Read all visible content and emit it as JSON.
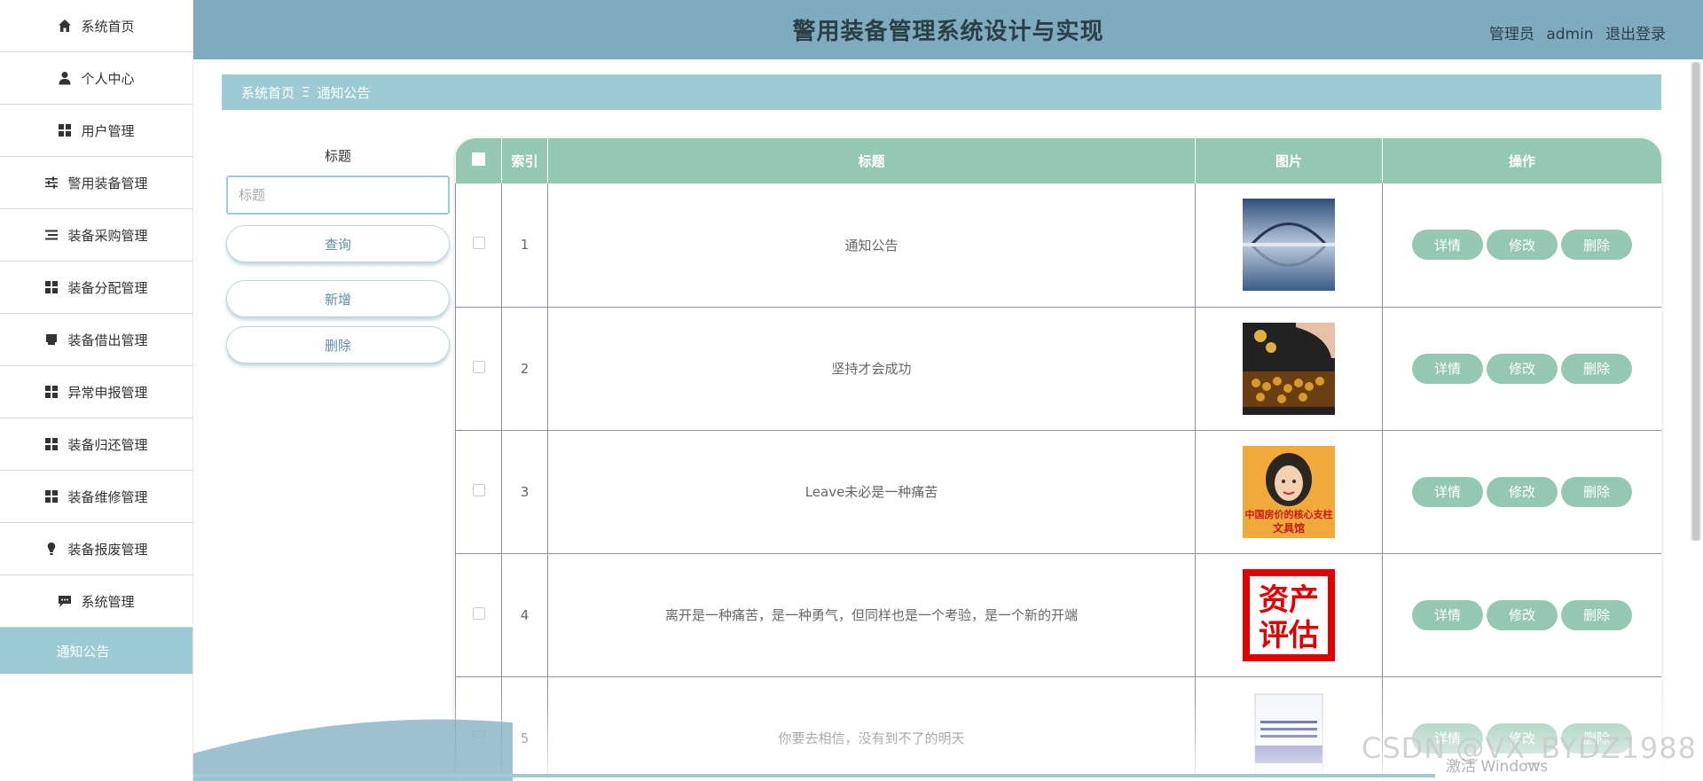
{
  "sidebar": {
    "items": [
      {
        "label": "系统首页",
        "icon": "home-icon"
      },
      {
        "label": "个人中心",
        "icon": "user-icon"
      },
      {
        "label": "用户管理",
        "icon": "grid-icon"
      },
      {
        "label": "警用装备管理",
        "icon": "sliders-icon"
      },
      {
        "label": "装备采购管理",
        "icon": "list-icon"
      },
      {
        "label": "装备分配管理",
        "icon": "grid-icon"
      },
      {
        "label": "装备借出管理",
        "icon": "inbox-icon"
      },
      {
        "label": "异常申报管理",
        "icon": "grid-icon"
      },
      {
        "label": "装备归还管理",
        "icon": "grid-icon"
      },
      {
        "label": "装备维修管理",
        "icon": "grid-icon"
      },
      {
        "label": "装备报废管理",
        "icon": "bulb-icon"
      },
      {
        "label": "系统管理",
        "icon": "chat-icon"
      }
    ],
    "active_sub": "通知公告"
  },
  "header": {
    "title": "警用装备管理系统设计与实现",
    "role": "管理员",
    "username": "admin",
    "logout": "退出登录"
  },
  "breadcrumb": {
    "home": "系统首页",
    "separator": "Ξ",
    "current": "通知公告"
  },
  "search": {
    "label": "标题",
    "placeholder": "标题",
    "query_button": "查询",
    "add_button": "新增",
    "delete_button": "删除"
  },
  "table": {
    "columns": [
      "索引",
      "标题",
      "图片",
      "操作"
    ],
    "actions": [
      "详情",
      "修改",
      "删除"
    ],
    "rows": [
      {
        "index": "1",
        "title": "通知公告",
        "image": "bridge-reflection-thumbnail"
      },
      {
        "index": "2",
        "title": "坚持才会成功",
        "image": "abacus-coins-thumbnail"
      },
      {
        "index": "3",
        "title": "Leave未必是一种痛苦",
        "image": "book-cover-portrait-thumbnail"
      },
      {
        "index": "4",
        "title": "离开是一种痛苦，是一种勇气，但同样也是一个考验，是一个新的开端",
        "image": "asset-valuation-stamp-thumbnail"
      },
      {
        "index": "5",
        "title": "你要去相信，没有到不了的明天",
        "image": "document-cover-thumbnail"
      }
    ]
  },
  "overlay": {
    "watermark": "CSDN @VX_BYDZ1988",
    "activate_windows": "激活 Windows"
  },
  "colors": {
    "header_bg": "#7fabbe",
    "breadcrumb_bg": "#9ccbd6",
    "table_header_bg": "#95c8b2",
    "action_button_bg": "#95c8b2"
  }
}
